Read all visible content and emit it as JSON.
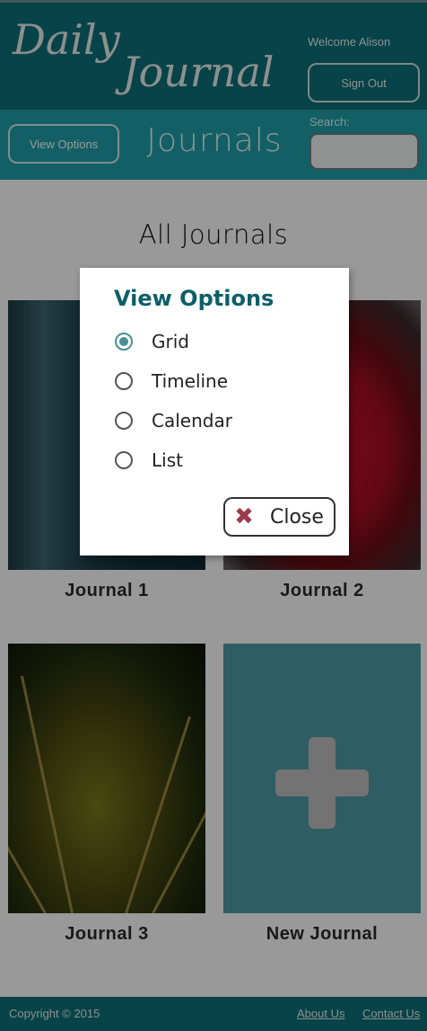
{
  "header": {
    "logo_line1": "Daily",
    "logo_line2": "Journal",
    "welcome": "Welcome Alison",
    "signout_label": "Sign Out"
  },
  "toolbar": {
    "view_options_label": "View Options",
    "section_title": "Journals",
    "search_label": "Search:",
    "search_value": ""
  },
  "main": {
    "title": "All Journals",
    "tiles": [
      {
        "label": "Journal 1"
      },
      {
        "label": "Journal 2"
      },
      {
        "label": "Journal 3"
      },
      {
        "label": "New Journal"
      }
    ]
  },
  "modal": {
    "title": "View Options",
    "options": [
      {
        "label": "Grid",
        "selected": true
      },
      {
        "label": "Timeline",
        "selected": false
      },
      {
        "label": "Calendar",
        "selected": false
      },
      {
        "label": "List",
        "selected": false
      }
    ],
    "close_label": "Close",
    "close_icon": "close-x-icon"
  },
  "footer": {
    "copyright": "Copyright © 2015",
    "about": "About Us",
    "contact": "Contact Us"
  },
  "colors": {
    "header_bg": "#0c7078",
    "toolbar_bg": "#1ea0a9",
    "accent": "#0c5f68",
    "new_tile_bg": "#4e9ca5",
    "close_icon": "#9b3a4a"
  }
}
